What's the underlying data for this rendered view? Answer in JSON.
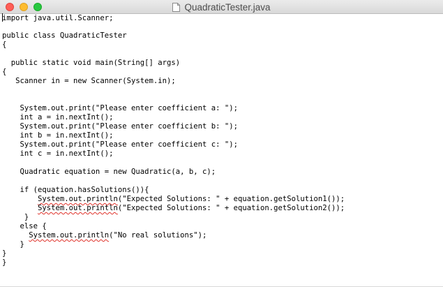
{
  "window": {
    "title": "QuadraticTester.java",
    "buttons": {
      "close": "close",
      "minimize": "minimize",
      "zoom": "zoom"
    }
  },
  "editor": {
    "lines": [
      "import java.util.Scanner;",
      "",
      "public class QuadraticTester",
      "{",
      "",
      "  public static void main(String[] args)",
      "{",
      "   Scanner in = new Scanner(System.in);",
      "",
      "",
      "    System.out.print(\"Please enter coefficient a: \");",
      "    int a = in.nextInt();",
      "    System.out.print(\"Please enter coefficient b: \");",
      "    int b = in.nextInt();",
      "    System.out.print(\"Please enter coefficient c: \");",
      "    int c = in.nextInt();",
      "",
      "    Quadratic equation = new Quadratic(a, b, c);",
      "",
      "    if (equation.hasSolutions()){",
      "        System.out.println(\"Expected Solutions: \" + equation.getSolution1());",
      "        System.out.println(\"Expected Solutions: \" + equation.getSolution2());",
      "     }",
      "    else {",
      "      System.out.println(\"No real solutions\");",
      "    }",
      "}",
      "}"
    ],
    "spellcheck_words": [
      "System.out.println"
    ],
    "spellcheck_color": "#e0322a"
  }
}
